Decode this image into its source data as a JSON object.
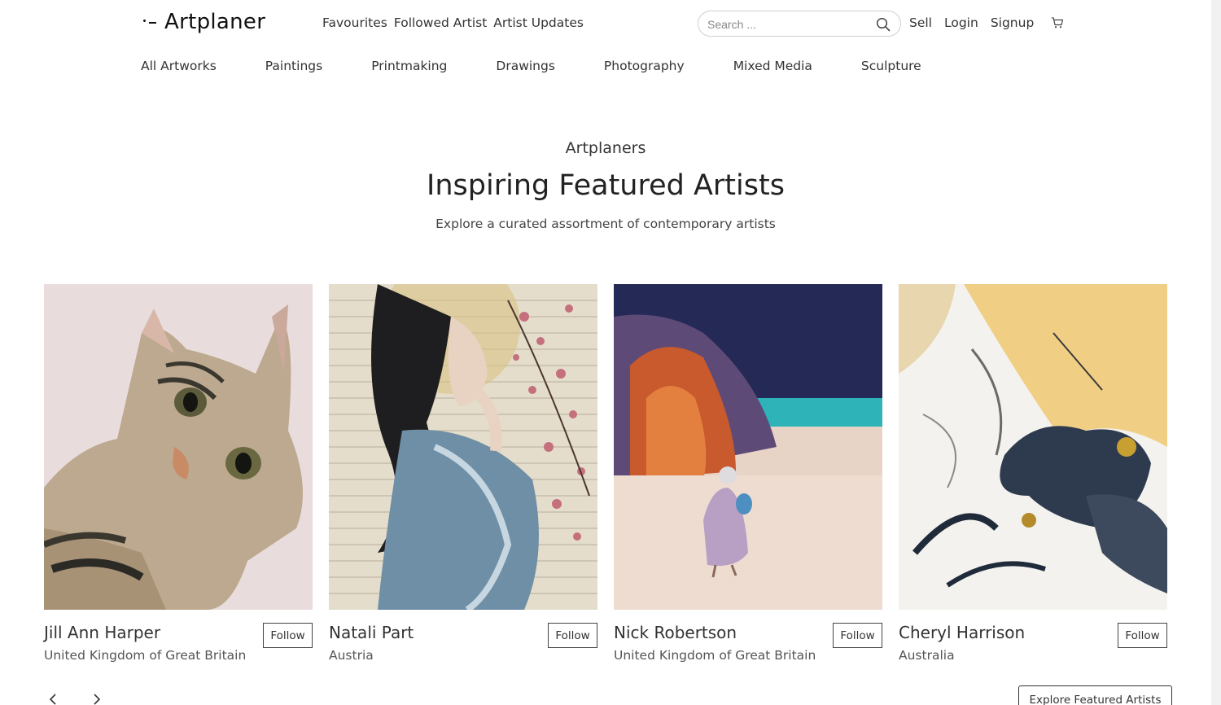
{
  "brand": {
    "name": "Artplaner"
  },
  "top_links": [
    "Favourites",
    "Followed Artist",
    "Artist Updates"
  ],
  "search": {
    "placeholder": "Search ..."
  },
  "auth_links": {
    "sell": "Sell",
    "login": "Login",
    "signup": "Signup"
  },
  "categories": [
    "All Artworks",
    "Paintings",
    "Printmaking",
    "Drawings",
    "Photography",
    "Mixed Media",
    "Sculpture"
  ],
  "hero": {
    "eyebrow": "Artplaners",
    "title": "Inspiring Featured Artists",
    "subtitle": "Explore a curated assortment of contemporary artists"
  },
  "artists": [
    {
      "name": "Jill Ann Harper",
      "country": "United Kingdom of Great Britain",
      "follow_label": "Follow"
    },
    {
      "name": "Natali Part",
      "country": "Austria",
      "follow_label": "Follow"
    },
    {
      "name": "Nick Robertson",
      "country": "United Kingdom of Great Britain",
      "follow_label": "Follow"
    },
    {
      "name": "Cheryl Harrison",
      "country": "Australia",
      "follow_label": "Follow"
    }
  ],
  "carousel": {
    "explore_label": "Explore Featured Artists"
  },
  "icons": {
    "search": "search-icon",
    "cart": "cart-icon",
    "prev": "chevron-left-icon",
    "next": "chevron-right-icon"
  }
}
